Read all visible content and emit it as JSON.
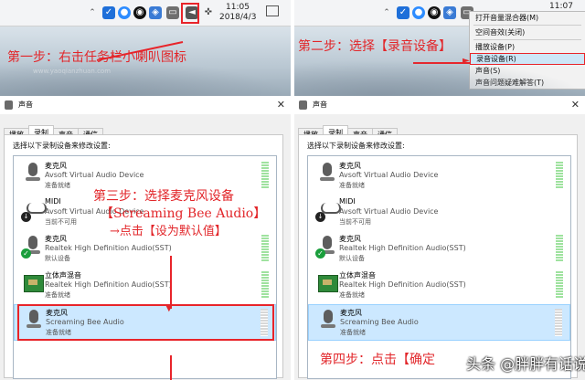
{
  "left": {
    "clock": {
      "time": "11:05",
      "date": "2018/4/3"
    },
    "step1": "第一步：右击任务栏小喇叭图标",
    "faint_text": "www.yaoqianzhuan.com",
    "dialog": {
      "title": "声音",
      "tabs": [
        "播放",
        "录制",
        "声音",
        "通信"
      ],
      "instruction": "选择以下录制设备来修改设置:",
      "devices": [
        {
          "name": "麦克风",
          "desc": "Avsoft Virtual Audio Device",
          "state": "准备就绪",
          "icon": "microphone-icon",
          "badge": ""
        },
        {
          "name": "MIDI",
          "desc": "Avsoft Virtual Audio Device",
          "state": "当前不可用",
          "icon": "cable-icon",
          "badge": "down"
        },
        {
          "name": "麦克风",
          "desc": "Realtek High Definition Audio(SST)",
          "state": "默认设备",
          "icon": "microphone-icon",
          "badge": "check"
        },
        {
          "name": "立体声混音",
          "desc": "Realtek High Definition Audio(SST)",
          "state": "准备就绪",
          "icon": "sound-card-icon",
          "badge": ""
        },
        {
          "name": "麦克风",
          "desc": "Screaming Bee Audio",
          "state": "准备就绪",
          "icon": "microphone-icon",
          "badge": ""
        }
      ]
    },
    "step3": {
      "line1": "第三步：选择麦克风设备",
      "line2": "【Screaming Bee Audio】",
      "line3": "→点击【设为默认值】"
    }
  },
  "right": {
    "clock": {
      "time": "11:07"
    },
    "step2": "第二步：选择【录音设备】",
    "context_menu": [
      {
        "label": "打开音量混合器(M)",
        "selected": false
      },
      {
        "label": "空间音效(关闭)",
        "selected": false
      },
      {
        "label": "播放设备(P)",
        "selected": false
      },
      {
        "label": "录音设备(R)",
        "selected": true
      },
      {
        "label": "声音(S)",
        "selected": false
      },
      {
        "label": "声音问题疑难解答(T)",
        "selected": false
      }
    ],
    "dialog": {
      "title": "声音",
      "tabs": [
        "播放",
        "录制",
        "声音",
        "通信"
      ],
      "instruction": "选择以下录制设备来修改设置:",
      "devices": [
        {
          "name": "麦克风",
          "desc": "Avsoft Virtual Audio Device",
          "state": "准备就绪"
        },
        {
          "name": "MIDI",
          "desc": "Avsoft Virtual Audio Device",
          "state": "当前不可用"
        },
        {
          "name": "麦克风",
          "desc": "Realtek High Definition Audio(SST)",
          "state": "默认设备"
        },
        {
          "name": "立体声混音",
          "desc": "Realtek High Definition Audio(SST)",
          "state": "准备就绪"
        },
        {
          "name": "麦克风",
          "desc": "Screaming Bee Audio",
          "state": "准备就绪"
        }
      ]
    },
    "step4": "第四步：点击【确定",
    "watermark": "头条 @胖胖有话说"
  },
  "colors": {
    "annotation_red": "#e2262a",
    "selection_blue": "#cce8ff",
    "menu_highlight": "#cde6f7"
  }
}
